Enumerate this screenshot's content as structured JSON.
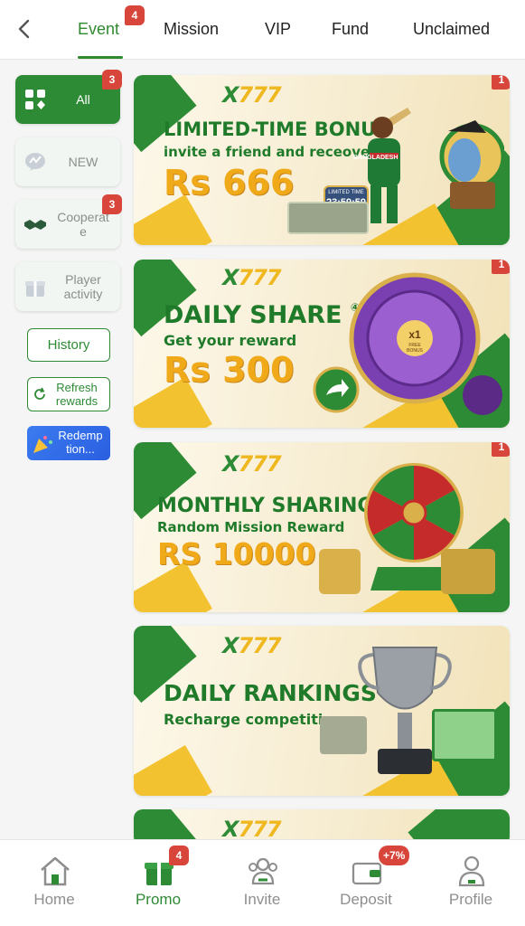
{
  "tabs": [
    {
      "label": "Event",
      "badge": "4"
    },
    {
      "label": "Mission"
    },
    {
      "label": "VIP"
    },
    {
      "label": "Fund"
    },
    {
      "label": "Unclaimed"
    }
  ],
  "sidebar": {
    "all": {
      "label": "All",
      "badge": "3"
    },
    "new": {
      "label": "NEW"
    },
    "cooperate": {
      "label": "Cooperat\ne",
      "badge": "3"
    },
    "player_activity": {
      "label": "Player activity"
    },
    "history": "History",
    "refresh": "Refresh rewards",
    "redemption": "Redemp tion..."
  },
  "banners": [
    {
      "logo": "X777",
      "title": "LIMITED-TIME BONUS",
      "subtitle": "invite a friend and receove",
      "amount": "Rs 666",
      "badge": "1",
      "timer_label": "LIMITED TIME",
      "timer": "23:59:59",
      "jersey": "BANGLADESH"
    },
    {
      "logo": "X777",
      "title": "DAILY SHARE",
      "title_mark": "④",
      "subtitle": "Get your reward",
      "amount": "Rs 300",
      "badge": "1",
      "wheel_center": "x1",
      "wheel_center_sub": "FREE BONUS"
    },
    {
      "logo": "X777",
      "title": "MONTHLY SHARING",
      "subtitle": "Random Mission Reward",
      "amount": "RS 10000",
      "badge": "1"
    },
    {
      "logo": "X777",
      "title": "DAILY RANKINGS",
      "subtitle": "Recharge competition"
    }
  ],
  "bottom_nav": [
    {
      "label": "Home",
      "icon": "home-icon"
    },
    {
      "label": "Promo",
      "icon": "gift-icon",
      "badge": "4"
    },
    {
      "label": "Invite",
      "icon": "invite-icon"
    },
    {
      "label": "Deposit",
      "icon": "wallet-icon",
      "badge": "+7%"
    },
    {
      "label": "Profile",
      "icon": "profile-icon"
    }
  ],
  "colors": {
    "accent": "#2e8b35",
    "badge": "#d8453b",
    "gold": "#f0a918"
  }
}
